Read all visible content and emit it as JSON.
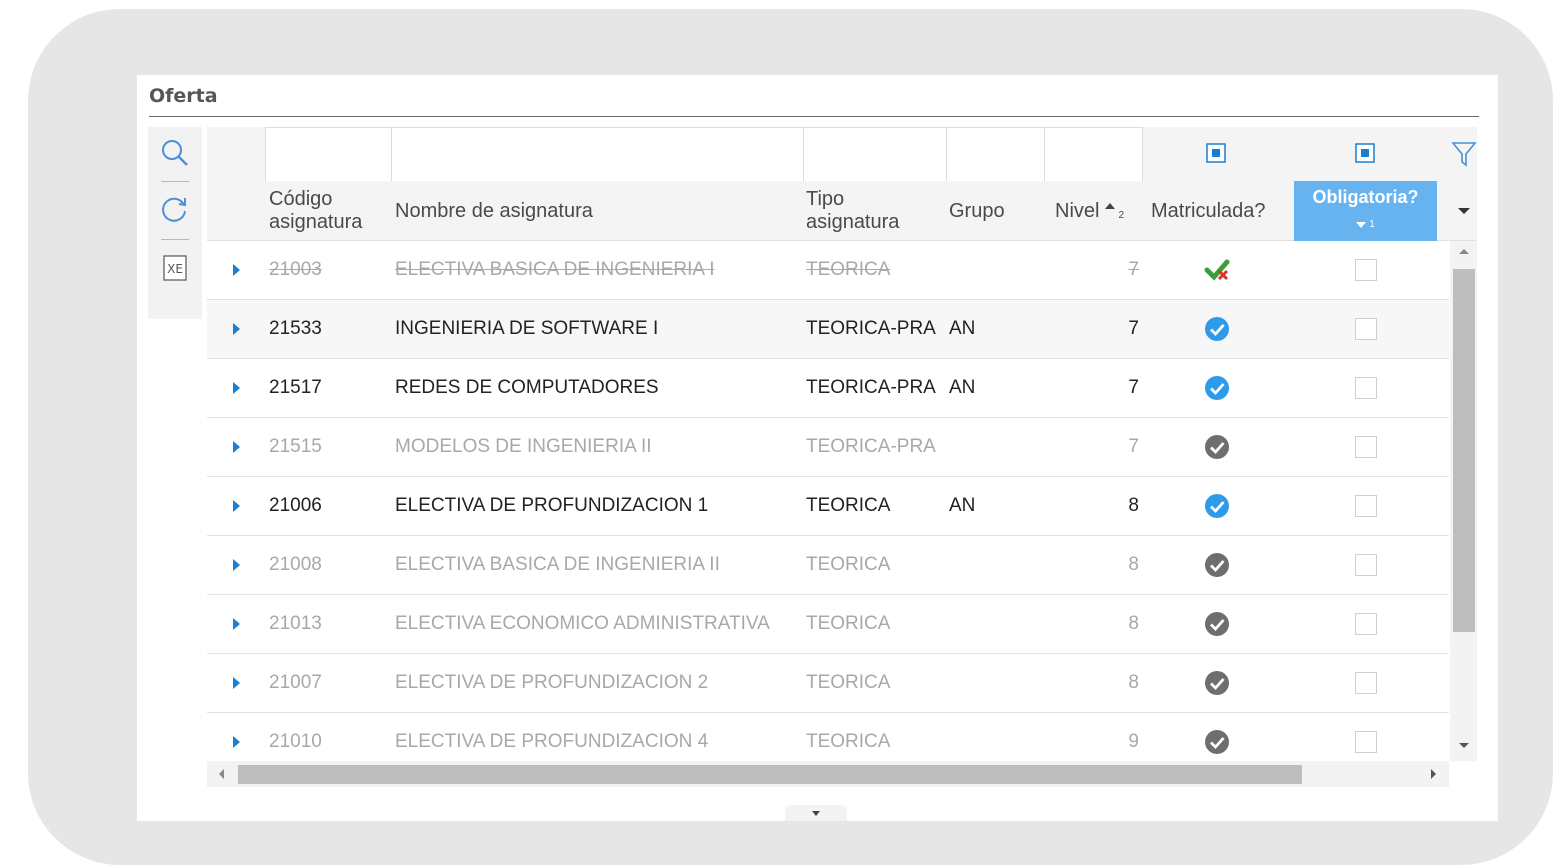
{
  "panel": {
    "title": "Oferta"
  },
  "toolbar": {
    "items": [
      {
        "name": "search-icon",
        "label": "Buscar"
      },
      {
        "name": "refresh-icon",
        "label": "Refrescar"
      },
      {
        "name": "excel-export-icon",
        "label": "Exportar a Excel"
      }
    ],
    "excel_glyph": "XE"
  },
  "colors": {
    "accent": "#1a7fd0",
    "header_selected": "#66b3f0",
    "check_blue": "#2e9bea",
    "check_gray": "#6e6e6e",
    "check_green": "#3aa13a"
  },
  "grid": {
    "columns": [
      {
        "key": "codigo",
        "label": "Código asignatura"
      },
      {
        "key": "nombre",
        "label": "Nombre de asignatura"
      },
      {
        "key": "tipo",
        "label": "Tipo asignatura"
      },
      {
        "key": "grupo",
        "label": "Grupo"
      },
      {
        "key": "nivel",
        "label": "Nivel",
        "sort": "asc",
        "sort_order": "2"
      },
      {
        "key": "matriculada",
        "label": "Matriculada?"
      },
      {
        "key": "obligatoria",
        "label": "Obligatoria?",
        "sort": "desc",
        "sort_order": "1"
      }
    ],
    "rows": [
      {
        "codigo": "21003",
        "nombre": "ELECTIVA BASICA DE INGENIERIA I",
        "tipo": "TEORICA",
        "grupo": "",
        "nivel": "7",
        "matriculada": "green",
        "obligatoria": false,
        "state": "strike"
      },
      {
        "codigo": "21533",
        "nombre": "INGENIERIA DE SOFTWARE I",
        "tipo": "TEORICA-PRA",
        "grupo": "AN",
        "nivel": "7",
        "matriculada": "blue",
        "obligatoria": false,
        "state": "active"
      },
      {
        "codigo": "21517",
        "nombre": "REDES DE COMPUTADORES",
        "tipo": "TEORICA-PRA",
        "grupo": "AN",
        "nivel": "7",
        "matriculada": "blue",
        "obligatoria": false,
        "state": "active"
      },
      {
        "codigo": "21515",
        "nombre": "MODELOS DE INGENIERIA II",
        "tipo": "TEORICA-PRA",
        "grupo": "",
        "nivel": "7",
        "matriculada": "gray",
        "obligatoria": false,
        "state": "inactive"
      },
      {
        "codigo": "21006",
        "nombre": "ELECTIVA DE PROFUNDIZACION 1",
        "tipo": "TEORICA",
        "grupo": "AN",
        "nivel": "8",
        "matriculada": "blue",
        "obligatoria": false,
        "state": "active"
      },
      {
        "codigo": "21008",
        "nombre": "ELECTIVA BASICA DE INGENIERIA II",
        "tipo": "TEORICA",
        "grupo": "",
        "nivel": "8",
        "matriculada": "gray",
        "obligatoria": false,
        "state": "inactive"
      },
      {
        "codigo": "21013",
        "nombre": "ELECTIVA ECONOMICO ADMINISTRATIVA",
        "tipo": "TEORICA",
        "grupo": "",
        "nivel": "8",
        "matriculada": "gray",
        "obligatoria": false,
        "state": "inactive"
      },
      {
        "codigo": "21007",
        "nombre": "ELECTIVA DE PROFUNDIZACION 2",
        "tipo": "TEORICA",
        "grupo": "",
        "nivel": "8",
        "matriculada": "gray",
        "obligatoria": false,
        "state": "inactive"
      },
      {
        "codigo": "21010",
        "nombre": "ELECTIVA DE PROFUNDIZACION 4",
        "tipo": "TEORICA",
        "grupo": "",
        "nivel": "9",
        "matriculada": "gray",
        "obligatoria": false,
        "state": "inactive"
      }
    ]
  }
}
